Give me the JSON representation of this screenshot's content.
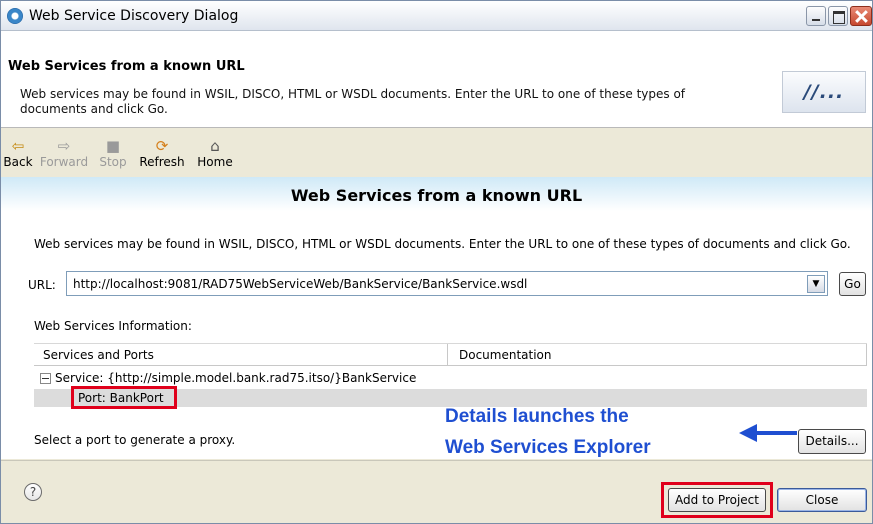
{
  "window": {
    "title": "Web Service Discovery Dialog"
  },
  "banner": {
    "title": "Web Services from a known URL",
    "description": "Web services may be found in WSIL, DISCO, HTML or WSDL documents. Enter the URL to one of these types of documents and click Go.",
    "logo_text": "//..."
  },
  "toolbar": {
    "back": "Back",
    "forward": "Forward",
    "stop": "Stop",
    "refresh": "Refresh",
    "home": "Home"
  },
  "content": {
    "title": "Web Services from a known URL",
    "description": "Web services may be found in WSIL, DISCO, HTML or WSDL documents. Enter the URL to one of these types of documents and click Go.",
    "url_label": "URL:",
    "url_value": "http://localhost:9081/RAD75WebServiceWeb/BankService/BankService.wsdl",
    "go_label": "Go",
    "info_label": "Web Services Information:",
    "columns": [
      "Services and Ports",
      "Documentation"
    ],
    "service": "Service: {http://simple.model.bank.rad75.itso/}BankService",
    "port": "Port: BankPort",
    "hint": "Select a port to generate a proxy.",
    "details_label": "Details...",
    "callout_line1": "Details launches the",
    "callout_line2": "Web Services Explorer"
  },
  "footer": {
    "help": "?",
    "add_to_project": "Add to Project",
    "close": "Close"
  },
  "colors": {
    "annotation_red": "#e0001b",
    "callout_blue": "#1f4fd1"
  },
  "icons": {
    "back": "arrow-left-icon",
    "forward": "arrow-right-icon",
    "stop": "stop-icon",
    "refresh": "refresh-icon",
    "home": "home-icon"
  }
}
